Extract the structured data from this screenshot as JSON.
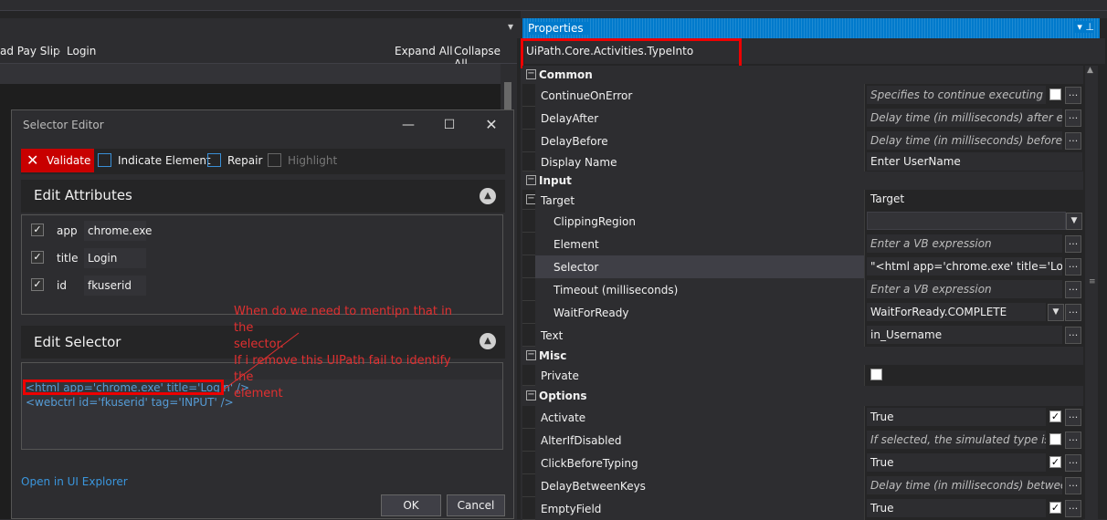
{
  "designer": {
    "breadcrumb": [
      "ad Pay Slip",
      "Login"
    ],
    "expand_all": "Expand All",
    "collapse_all": "Collapse All"
  },
  "selector_editor": {
    "title": "Selector Editor",
    "toolbar": {
      "validate": "Validate",
      "indicate": "Indicate Element",
      "repair": "Repair",
      "highlight": "Highlight"
    },
    "edit_attributes_title": "Edit Attributes",
    "attributes": [
      {
        "checked": true,
        "name": "app",
        "value": "chrome.exe"
      },
      {
        "checked": true,
        "name": "title",
        "value": "Login"
      },
      {
        "checked": true,
        "name": "id",
        "value": "fkuserid"
      }
    ],
    "edit_selector_title": "Edit Selector",
    "selector_lines": [
      "<html app='chrome.exe' title='Login' />",
      "<webctrl id='fkuserid' tag='INPUT' />"
    ],
    "open_in_ui_explorer": "Open in UI Explorer",
    "ok": "OK",
    "cancel": "Cancel"
  },
  "annotation": {
    "line1": "When do we need to mentipn that in the",
    "line2": "selector.",
    "line3": "If i remove this UIPath fail to identify the",
    "line4": "element"
  },
  "properties": {
    "panel_title": "Properties",
    "activity_type": "UiPath.Core.Activities.TypeInto",
    "categories": {
      "common": "Common",
      "input": "Input",
      "misc": "Misc",
      "options": "Options"
    },
    "rows": {
      "continue_on_error": {
        "name": "ContinueOnError",
        "value": "Specifies to continue executing the re"
      },
      "delay_after": {
        "name": "DelayAfter",
        "value": "Delay time (in milliseconds) after execut"
      },
      "delay_before": {
        "name": "DelayBefore",
        "value": "Delay time (in milliseconds) before the a"
      },
      "display_name": {
        "name": "Display Name",
        "value": "Enter UserName"
      },
      "target": {
        "name": "Target",
        "value": "Target"
      },
      "clipping_region": {
        "name": "ClippingRegion",
        "value": ""
      },
      "element": {
        "name": "Element",
        "value": "Enter a VB expression"
      },
      "selector": {
        "name": "Selector",
        "value": "\"<html app='chrome.exe' title='Login' /"
      },
      "timeout": {
        "name": "Timeout (milliseconds)",
        "value": "Enter a VB expression"
      },
      "wait_for_ready": {
        "name": "WaitForReady",
        "value": "WaitForReady.COMPLETE"
      },
      "text": {
        "name": "Text",
        "value": "in_Username"
      },
      "private": {
        "name": "Private",
        "value": ""
      },
      "activate": {
        "name": "Activate",
        "value": "True"
      },
      "alter_if_disabled": {
        "name": "AlterIfDisabled",
        "value": "If selected, the simulated type is exec"
      },
      "click_before_typing": {
        "name": "ClickBeforeTyping",
        "value": "True"
      },
      "delay_between_keys": {
        "name": "DelayBetweenKeys",
        "value": "Delay time (in milliseconds) between two"
      },
      "empty_field": {
        "name": "EmptyField",
        "value": "True"
      }
    }
  },
  "colors": {
    "accent": "#007acc",
    "validate_red": "#c80000",
    "annotation_red": "#e03030",
    "background": "#2d2d30"
  }
}
